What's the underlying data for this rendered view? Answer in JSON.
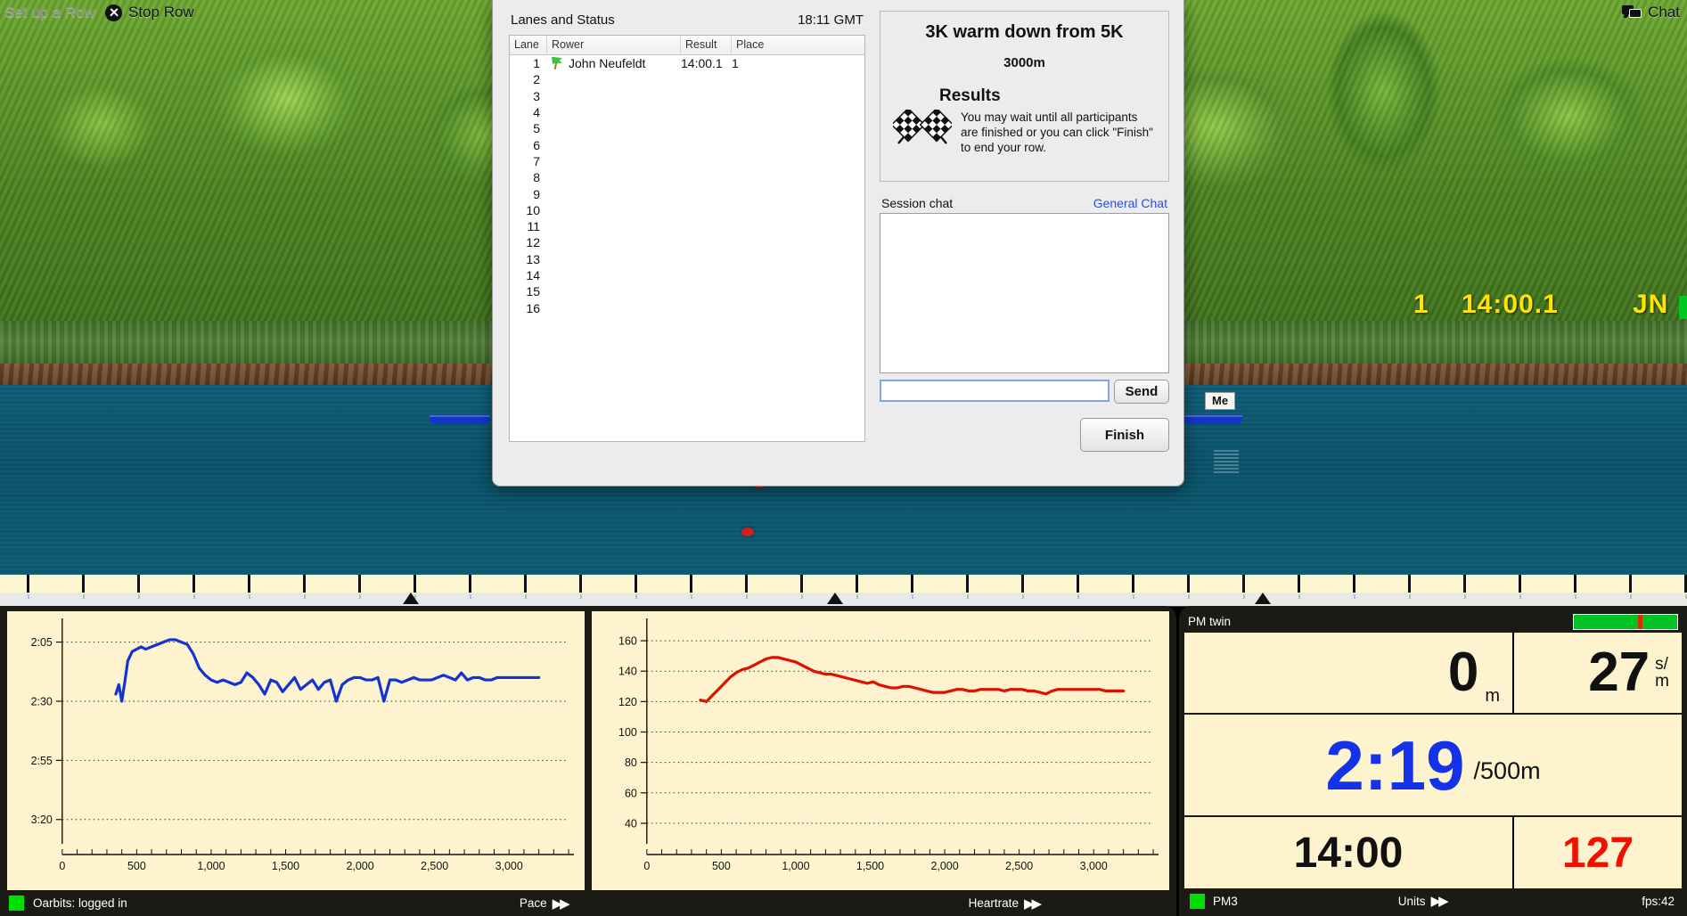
{
  "toolbar": {
    "setup_label": "Set up a Row",
    "stop_label": "Stop Row",
    "chat_label": "Chat"
  },
  "scene": {
    "me_label": "Me",
    "hud_place": "1",
    "hud_time": "14:00.1",
    "hud_initials": "JN"
  },
  "dialog": {
    "lanes_title": "Lanes and Status",
    "clock": "18:11 GMT",
    "columns": [
      "Lane",
      "Rower",
      "Result",
      "Place"
    ],
    "rows": [
      {
        "lane": "1",
        "rower": "John Neufeldt",
        "result": "14:00.1",
        "place": "1"
      },
      {
        "lane": "2",
        "rower": "",
        "result": "",
        "place": ""
      },
      {
        "lane": "3",
        "rower": "",
        "result": "",
        "place": ""
      },
      {
        "lane": "4",
        "rower": "",
        "result": "",
        "place": ""
      },
      {
        "lane": "5",
        "rower": "",
        "result": "",
        "place": ""
      },
      {
        "lane": "6",
        "rower": "",
        "result": "",
        "place": ""
      },
      {
        "lane": "7",
        "rower": "",
        "result": "",
        "place": ""
      },
      {
        "lane": "8",
        "rower": "",
        "result": "",
        "place": ""
      },
      {
        "lane": "9",
        "rower": "",
        "result": "",
        "place": ""
      },
      {
        "lane": "10",
        "rower": "",
        "result": "",
        "place": ""
      },
      {
        "lane": "11",
        "rower": "",
        "result": "",
        "place": ""
      },
      {
        "lane": "12",
        "rower": "",
        "result": "",
        "place": ""
      },
      {
        "lane": "13",
        "rower": "",
        "result": "",
        "place": ""
      },
      {
        "lane": "14",
        "rower": "",
        "result": "",
        "place": ""
      },
      {
        "lane": "15",
        "rower": "",
        "result": "",
        "place": ""
      },
      {
        "lane": "16",
        "rower": "",
        "result": "",
        "place": ""
      }
    ],
    "session_title": "3K warm down from 5K",
    "session_distance": "3000m",
    "results_heading": "Results",
    "results_text": "You may wait until all participants are finished or you can click \"Finish\" to end your row.",
    "chat_label": "Session chat",
    "general_chat_link": "General Chat",
    "chat_log": "",
    "chat_input_value": "",
    "chat_input_placeholder": "",
    "send_label": "Send",
    "finish_label": "Finish"
  },
  "status_bar": {
    "oarbits_label": "Oarbits: logged in",
    "pace_label": "Pace",
    "heartrate_label": "Heartrate",
    "forward_glyph": "▶▶"
  },
  "pm": {
    "title": "PM twin",
    "distance_value": "0",
    "distance_unit": "m",
    "rate_value": "27",
    "rate_unit_top": "s/",
    "rate_unit_bottom": "m",
    "pace_value": "2:19",
    "pace_unit": "/500m",
    "time_value": "14:00",
    "heartrate_value": "127",
    "device_label": "PM3",
    "units_label": "Units",
    "fps_label": "fps:42",
    "accent_pace": "#1433e8",
    "accent_hr": "#ef1000",
    "accent_led": "#00e000"
  },
  "chart_data": [
    {
      "type": "line",
      "title": "Pace",
      "xlabel": "",
      "ylabel": "",
      "color": "#1433d2",
      "grid": true,
      "legend": "none",
      "xlim": [
        0,
        3400
      ],
      "ytick_labels": [
        "2:05",
        "2:30",
        "2:55",
        "3:20"
      ],
      "ytick_values": [
        125,
        150,
        175,
        200
      ],
      "ylim_seconds": [
        118,
        208
      ],
      "xtick_labels": [
        "0",
        "500",
        "1,000",
        "1,500",
        "2,000",
        "2,500",
        "3,000"
      ],
      "xtick_values": [
        0,
        500,
        1000,
        1500,
        2000,
        2500,
        3000
      ],
      "x": [
        360,
        380,
        400,
        420,
        440,
        470,
        500,
        530,
        560,
        600,
        640,
        680,
        720,
        760,
        800,
        840,
        880,
        920,
        960,
        1000,
        1040,
        1080,
        1120,
        1160,
        1200,
        1240,
        1280,
        1320,
        1360,
        1400,
        1440,
        1480,
        1520,
        1560,
        1600,
        1640,
        1680,
        1720,
        1760,
        1800,
        1840,
        1880,
        1920,
        1960,
        2000,
        2040,
        2080,
        2120,
        2160,
        2200,
        2240,
        2280,
        2320,
        2360,
        2400,
        2440,
        2480,
        2520,
        2560,
        2600,
        2640,
        2680,
        2720,
        2760,
        2800,
        2840,
        2880,
        2920,
        2960,
        3000,
        3040,
        3080,
        3120,
        3160,
        3200
      ],
      "y_seconds": [
        147,
        143,
        150,
        142,
        133,
        129,
        128,
        127,
        128,
        127,
        126,
        125,
        124,
        124,
        125,
        126,
        130,
        136,
        139,
        141,
        142,
        141,
        142,
        143,
        142,
        138,
        140,
        143,
        147,
        141,
        142,
        146,
        143,
        140,
        145,
        143,
        141,
        145,
        142,
        141,
        150,
        143,
        141,
        140,
        140,
        141,
        141,
        140,
        150,
        141,
        141,
        142,
        141,
        140,
        141,
        141,
        141,
        140,
        139,
        140,
        141,
        138,
        141,
        140,
        140,
        141,
        141,
        140,
        140,
        140,
        140,
        140,
        140,
        140,
        140
      ]
    },
    {
      "type": "line",
      "title": "Heartrate",
      "xlabel": "",
      "ylabel": "",
      "color": "#e01000",
      "grid": true,
      "legend": "none",
      "xlim": [
        0,
        3400
      ],
      "ytick_labels": [
        "160",
        "140",
        "120",
        "100",
        "80",
        "60",
        "40"
      ],
      "ytick_values": [
        160,
        140,
        120,
        100,
        80,
        60,
        40
      ],
      "ylim": [
        30,
        170
      ],
      "xtick_labels": [
        "0",
        "500",
        "1,000",
        "1,500",
        "2,000",
        "2,500",
        "3,000"
      ],
      "xtick_values": [
        0,
        500,
        1000,
        1500,
        2000,
        2500,
        3000
      ],
      "x": [
        360,
        400,
        440,
        480,
        520,
        560,
        600,
        640,
        680,
        720,
        760,
        800,
        840,
        880,
        920,
        960,
        1000,
        1040,
        1080,
        1120,
        1160,
        1200,
        1240,
        1280,
        1320,
        1360,
        1400,
        1440,
        1480,
        1520,
        1560,
        1600,
        1640,
        1680,
        1720,
        1760,
        1800,
        1840,
        1880,
        1920,
        1960,
        2000,
        2040,
        2080,
        2120,
        2160,
        2200,
        2240,
        2280,
        2320,
        2360,
        2400,
        2440,
        2480,
        2520,
        2560,
        2600,
        2640,
        2680,
        2720,
        2760,
        2800,
        2840,
        2880,
        2920,
        2960,
        3000,
        3040,
        3080,
        3120,
        3160,
        3200
      ],
      "y": [
        121,
        120,
        124,
        128,
        132,
        136,
        139,
        141,
        142,
        144,
        146,
        148,
        149,
        149,
        148,
        147,
        146,
        144,
        142,
        140,
        139,
        138,
        138,
        137,
        136,
        135,
        134,
        133,
        132,
        133,
        131,
        130,
        129,
        129,
        130,
        130,
        129,
        128,
        127,
        126,
        126,
        126,
        127,
        128,
        128,
        127,
        127,
        128,
        128,
        128,
        128,
        127,
        128,
        128,
        128,
        127,
        127,
        126,
        125,
        127,
        128,
        128,
        128,
        128,
        128,
        128,
        128,
        128,
        127,
        127,
        127,
        127
      ]
    }
  ]
}
